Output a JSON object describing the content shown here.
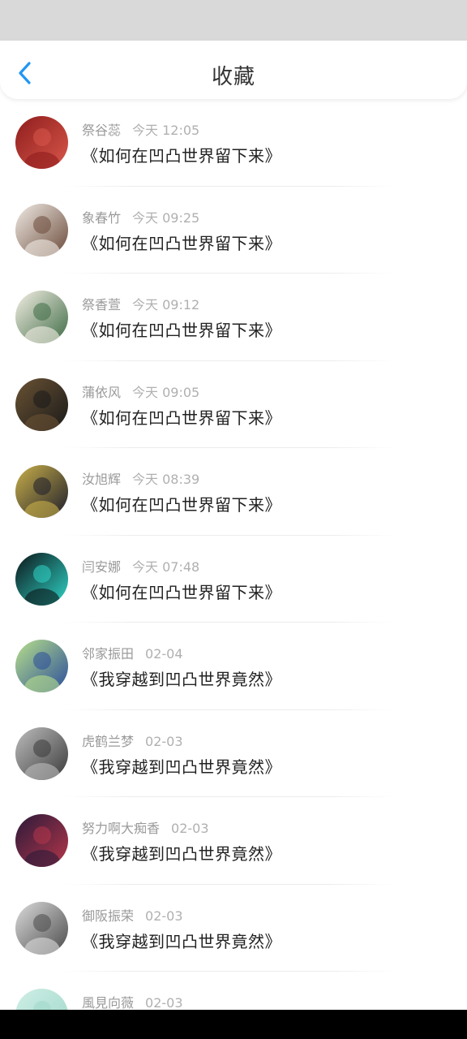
{
  "header": {
    "title": "收藏",
    "back_icon": "chevron-left-icon",
    "accent": "#2196f3"
  },
  "items": [
    {
      "name": "祭谷蕊",
      "time": "今天 12:05",
      "title": "《如何在凹凸世界留下来》",
      "avatar_colors": [
        "#8e1d1d",
        "#d9574a"
      ]
    },
    {
      "name": "象春竹",
      "time": "今天 09:25",
      "title": "《如何在凹凸世界留下来》",
      "avatar_colors": [
        "#f1ece6",
        "#6b4a3a"
      ]
    },
    {
      "name": "祭香萱",
      "time": "今天 09:12",
      "title": "《如何在凹凸世界留下来》",
      "avatar_colors": [
        "#f4efe4",
        "#3e6b45"
      ]
    },
    {
      "name": "蒲依风",
      "time": "今天 09:05",
      "title": "《如何在凹凸世界留下来》",
      "avatar_colors": [
        "#6a5233",
        "#1a1a1a"
      ]
    },
    {
      "name": "汝旭辉",
      "time": "今天 08:39",
      "title": "《如何在凹凸世界留下来》",
      "avatar_colors": [
        "#c9b04a",
        "#1d1d2b"
      ]
    },
    {
      "name": "闫安娜",
      "time": "今天 07:48",
      "title": "《如何在凹凸世界留下来》",
      "avatar_colors": [
        "#0c1418",
        "#2fd6c8"
      ]
    },
    {
      "name": "邻家振田",
      "time": "02-04",
      "title": "《我穿越到凹凸世界竟然》",
      "avatar_colors": [
        "#b8e08a",
        "#2a4d9b"
      ]
    },
    {
      "name": "虎鹤兰梦",
      "time": "02-03",
      "title": "《我穿越到凹凸世界竟然》",
      "avatar_colors": [
        "#bdbdbd",
        "#3a3a3a"
      ]
    },
    {
      "name": "努力啊大痴香",
      "time": "02-03",
      "title": "《我穿越到凹凸世界竟然》",
      "avatar_colors": [
        "#2a1a3a",
        "#b5364a"
      ]
    },
    {
      "name": "御阪振荣",
      "time": "02-03",
      "title": "《我穿越到凹凸世界竟然》",
      "avatar_colors": [
        "#dcdcdc",
        "#4a4a4a"
      ]
    },
    {
      "name": "風見向薇",
      "time": "02-03",
      "title": "",
      "avatar_colors": [
        "#cfeee6",
        "#9fd8c8"
      ]
    }
  ]
}
